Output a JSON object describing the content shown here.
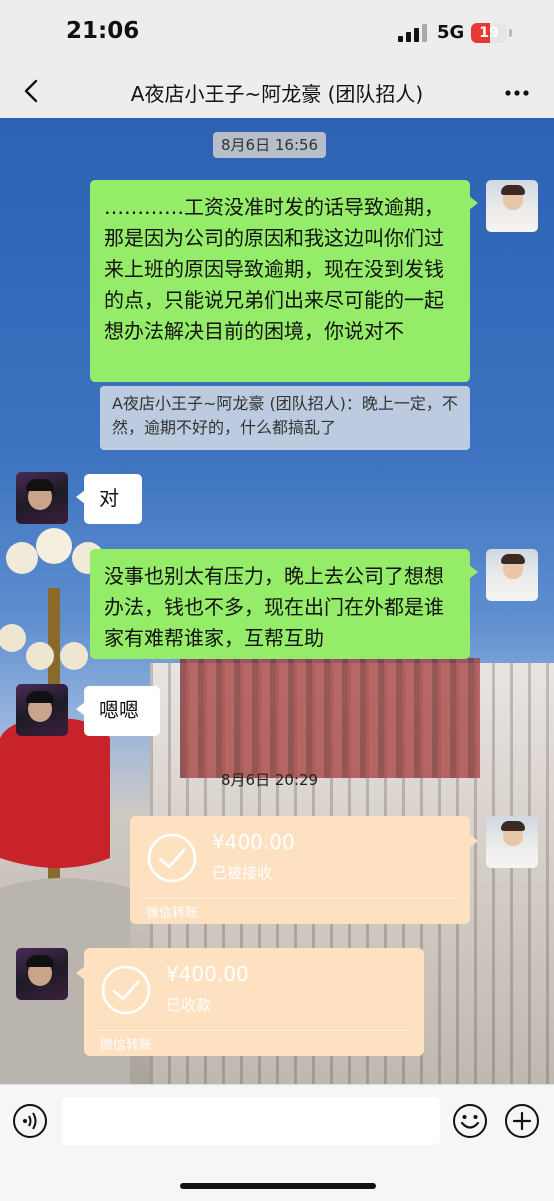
{
  "status": {
    "time": "21:06",
    "network": "5G",
    "battery": "19",
    "battery_level_percent": 19
  },
  "header": {
    "title": "A夜店小王子~阿龙豪 (团队招人)",
    "back_icon": "chevron-left-icon",
    "more_icon": "more-horizontal-icon"
  },
  "chat": {
    "timestamp1": "8月6日 16:56",
    "msg1": "…………工资没准时发的话导致逾期，那是因为公司的原因和我这边叫你们过来上班的原因导致逾期，现在没到发钱的点，只能说兄弟们出来尽可能的一起想办法解决目前的困境，你说对不",
    "quote1": "A夜店小王子~阿龙豪 (团队招人)：晚上一定，不然，逾期不好的，什么都搞乱了",
    "msg2": "对",
    "msg3": "没事也别太有压力，晚上去公司了想想办法，钱也不多，现在出门在外都是谁家有难帮谁家，互帮互助",
    "msg4": "嗯嗯",
    "timestamp2": "8月6日 20:29",
    "transfer1": {
      "amount": "¥400.00",
      "status": "已被接收",
      "label": "微信转账"
    },
    "transfer2": {
      "amount": "¥400.00",
      "status": "已收款",
      "label": "微信转账"
    }
  },
  "inputbar": {
    "voice_icon": "voice-icon",
    "emoji_icon": "emoji-icon",
    "plus_icon": "plus-icon"
  },
  "colors": {
    "bubble_green": "#95ec69",
    "transfer_bg": "#fde1c1",
    "battery_red": "#e53935"
  }
}
